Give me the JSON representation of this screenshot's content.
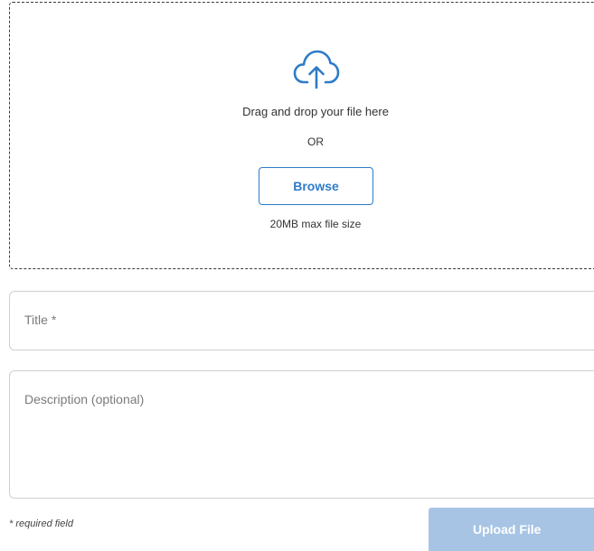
{
  "dropzone": {
    "icon": "cloud-upload-icon",
    "instruction": "Drag and drop your file here",
    "or_label": "OR",
    "browse_label": "Browse",
    "max_size": "20MB max file size"
  },
  "form": {
    "title_placeholder": "Title *",
    "description_placeholder": "Description (optional)",
    "required_note": "* required field",
    "upload_label": "Upload File"
  },
  "colors": {
    "accent": "#2f7bc8",
    "upload_disabled": "#a7c4e5"
  }
}
